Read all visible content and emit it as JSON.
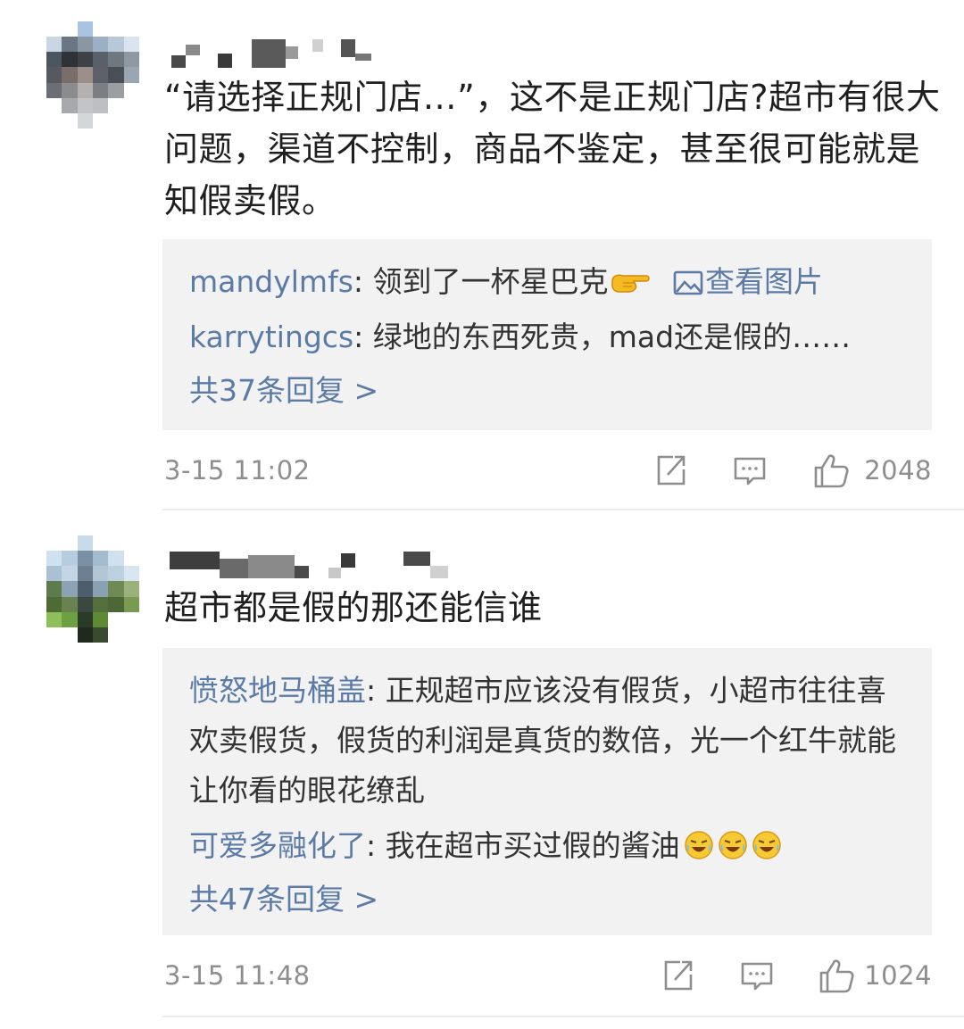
{
  "comments": [
    {
      "text": "“请选择正规门店…”，这不是正规门店?超市有很大问题，渠道不控制，商品不鉴定，甚至很可能就是知假卖假。",
      "replies": [
        {
          "user": "mandylmfs",
          "sep": ": ",
          "text": "领到了一杯星巴克",
          "emoji": "pointing-hand-emoji",
          "link": "查看图片"
        },
        {
          "user": "karrytingcs",
          "sep": ": ",
          "text": "绿地的东西死贵，mad还是假的……"
        }
      ],
      "more": "共37条回复 >",
      "time": "3-15 11:02",
      "likes": "2048"
    },
    {
      "text": "超市都是假的那还能信谁",
      "replies": [
        {
          "user": "愤怒地马桶盖",
          "sep": ": ",
          "text": "正规超市应该没有假货，小超市往往喜欢卖假货，假货的利润是真货的数倍，光一个红牛就能让你看的眼花缭乱"
        },
        {
          "user": "可爱多融化了",
          "sep": ": ",
          "text": "我在超市买过假的酱油",
          "emoji": "laughing-crying-emoji x3"
        }
      ],
      "more": "共47条回复 >",
      "time": "3-15 11:48",
      "likes": "1024"
    }
  ],
  "colors": {
    "link": "#5b7ba6",
    "meta": "#8e8e8e",
    "reply_bg": "#f2f2f2"
  },
  "icons": [
    "share-icon",
    "comment-icon",
    "thumbs-up-icon",
    "image-icon"
  ]
}
